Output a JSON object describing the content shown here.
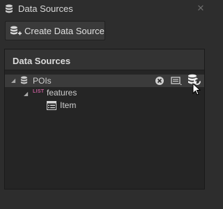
{
  "window": {
    "title": "Data Sources",
    "close_symbol": "✕"
  },
  "toolbar": {
    "create_label": "Create Data Source"
  },
  "panel": {
    "header": "Data Sources"
  },
  "tree": {
    "root": {
      "label": "POIs",
      "expanded": true,
      "selected": true
    },
    "child": {
      "label": "features",
      "type_tag": "LIST",
      "expanded": true
    },
    "leaf": {
      "label": "Item"
    }
  },
  "icons": {
    "title": "database-icon",
    "create": "database-add-icon",
    "root": "database-icon",
    "list": "list-type-icon",
    "item": "table-item-icon",
    "remove": "remove-circle-icon",
    "edit": "edit-data-icon",
    "refresh": "refresh-data-icon",
    "cursor": "mouse-cursor-icon"
  },
  "colors": {
    "background": "#2d2d2d",
    "panel": "#252525",
    "header": "#333333",
    "selection": "#3b3b3b",
    "list_tag": "#c25b96"
  }
}
